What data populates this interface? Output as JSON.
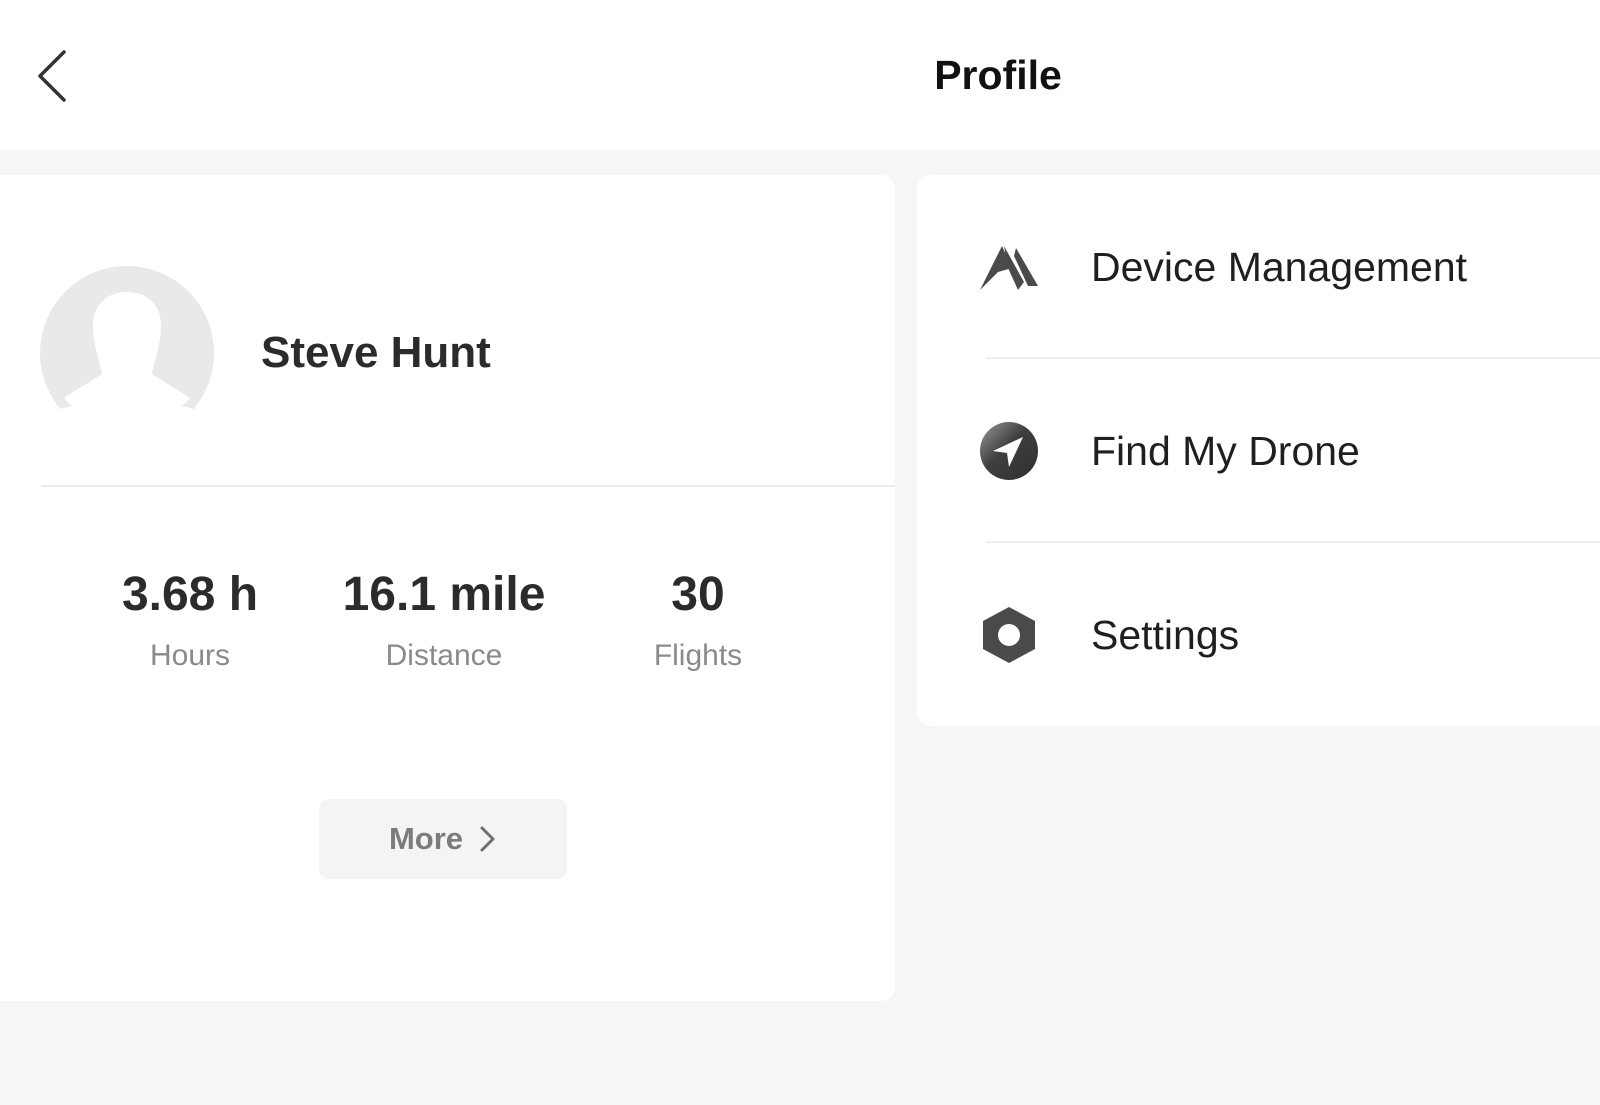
{
  "header": {
    "title": "Profile",
    "back_icon": "chevron-left-icon"
  },
  "profile": {
    "name": "Steve Hunt",
    "avatar_icon": "user-avatar-placeholder",
    "stats": [
      {
        "value": "3.68 h",
        "label": "Hours"
      },
      {
        "value": "16.1 mile",
        "label": "Distance"
      },
      {
        "value": "30",
        "label": "Flights"
      }
    ],
    "more_label": "More"
  },
  "menu": {
    "items": [
      {
        "label": "Device Management",
        "icon": "device-icon"
      },
      {
        "label": "Find My Drone",
        "icon": "compass-icon"
      },
      {
        "label": "Settings",
        "icon": "settings-hex-icon"
      }
    ]
  },
  "colors": {
    "background": "#f5f6f8",
    "card": "#ffffff",
    "text_primary": "#2b2b2b",
    "text_secondary": "#8a8a8a",
    "icon": "#444444",
    "button_bg": "#f3f4f6"
  }
}
